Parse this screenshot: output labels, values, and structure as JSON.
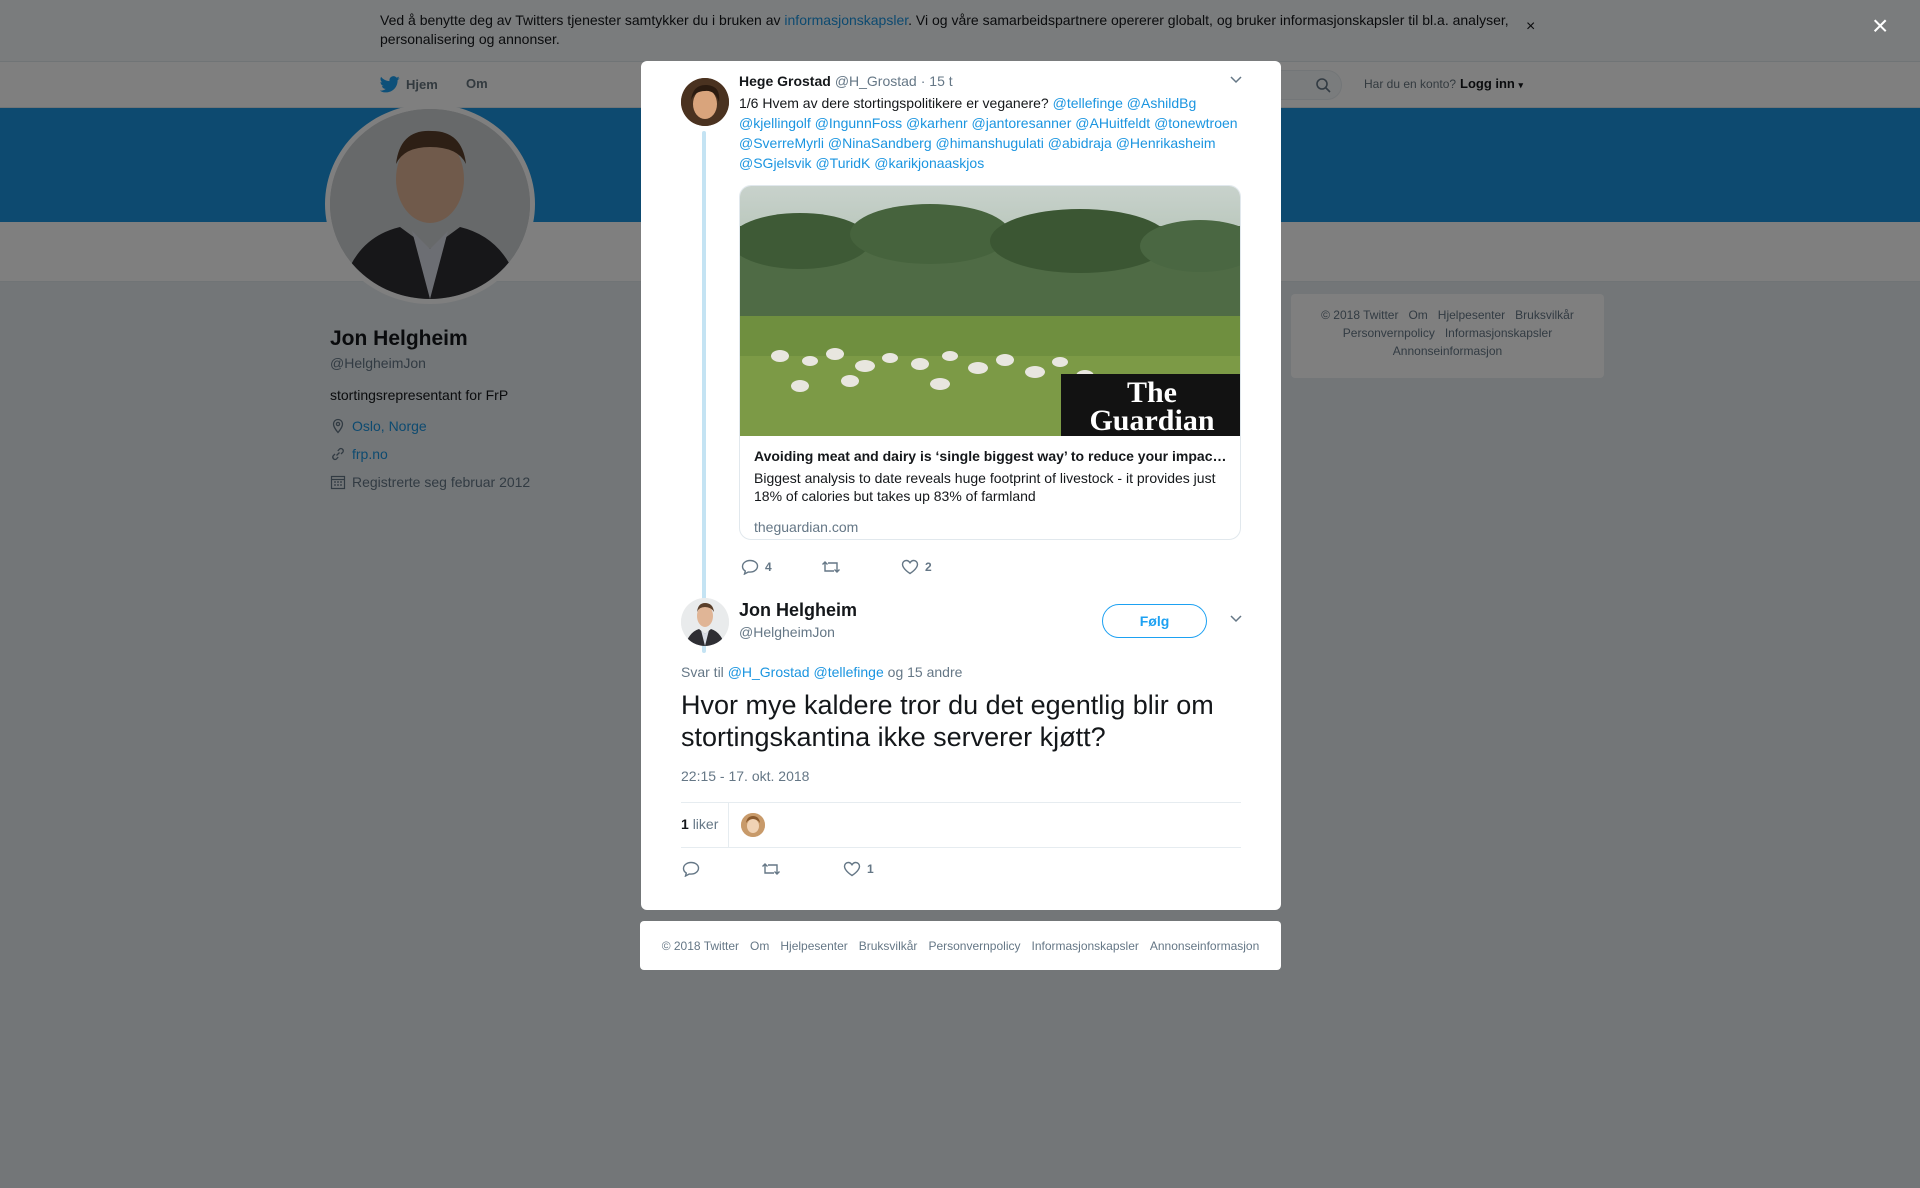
{
  "cookie_banner": {
    "text_before": "Ved å benytte deg av Twitters tjenester samtykker du i bruken av ",
    "link": "informasjonskapsler",
    "text_after": ". Vi og våre samarbeidspartnere opererer globalt, og bruker informasjonskapsler til bl.a. analyser, personalisering og annonser.",
    "close": "×"
  },
  "nav": {
    "home": "Hjem",
    "about": "Om",
    "have_account": "Har du en konto?",
    "login": "Logg inn"
  },
  "profile": {
    "name": "Jon Helgheim",
    "handle": "@HelgheimJon",
    "bio": "stortingsrepresentant for FrP",
    "location": "Oslo, Norge",
    "website": "frp.no",
    "joined": "Registrerte seg februar 2012"
  },
  "side_footer": {
    "line1": [
      "© 2018 Twitter",
      "Om",
      "Hjelpesenter",
      "Bruksvilkår"
    ],
    "line2": [
      "Personvernpolicy",
      "Informasjonskapsler"
    ],
    "line3": [
      "Annonseinformasjon"
    ]
  },
  "overlay": {
    "close": "×"
  },
  "parent_tweet": {
    "name": "Hege Grostad",
    "handle": "@H_Grostad",
    "time": "· 15 t",
    "text": "1/6 Hvem av dere stortingspolitikere er veganere?",
    "mentions_line1": [
      "@tellefinge",
      "@AshildBg"
    ],
    "mentions_line2": [
      "@kjellingolf",
      "@IngunnFoss",
      "@karhenr",
      "@jantoresanner",
      "@AHuitfeldt",
      "@tonewtroen"
    ],
    "mentions_line3": [
      "@SverreMyrli",
      "@NinaSandberg",
      "@himanshugulati",
      "@abidraja",
      "@Henrikasheim"
    ],
    "mentions_line4": [
      "@SGjelsvik",
      "@TuridK",
      "@karikjonaaskjos"
    ],
    "card": {
      "logo_line1": "The",
      "logo_line2": "Guardian",
      "title": "Avoiding meat and dairy is ‘single biggest way’ to reduce your impact on earth",
      "description": "Biggest analysis to date reveals huge footprint of livestock - it provides just 18% of calories but takes up 83% of farmland",
      "domain": "theguardian.com"
    },
    "replies": "4",
    "retweets": "",
    "likes": "2"
  },
  "main_tweet": {
    "name": "Jon Helgheim",
    "handle": "@HelgheimJon",
    "follow": "Følg",
    "reply_to_prefix": "Svar til",
    "reply_to_1": "@H_Grostad",
    "reply_to_2": "@tellefinge",
    "reply_to_suffix": "og 15 andre",
    "text": "Hvor mye kaldere tror du det egentlig blir om stortingskantina ikke serverer kjøtt?",
    "timestamp": "22:15 - 17. okt. 2018",
    "likes_count": "1",
    "likes_label": "liker",
    "replies": "",
    "retweets": "",
    "likes": "1"
  },
  "modal_footer": [
    "© 2018 Twitter",
    "Om",
    "Hjelpesenter",
    "Bruksvilkår",
    "Personvernpolicy",
    "Informasjonskapsler",
    "Annonseinformasjon"
  ],
  "colors": {
    "brand": "#1da1f2",
    "link": "#1b95e0",
    "banner": "#1b95e0"
  }
}
